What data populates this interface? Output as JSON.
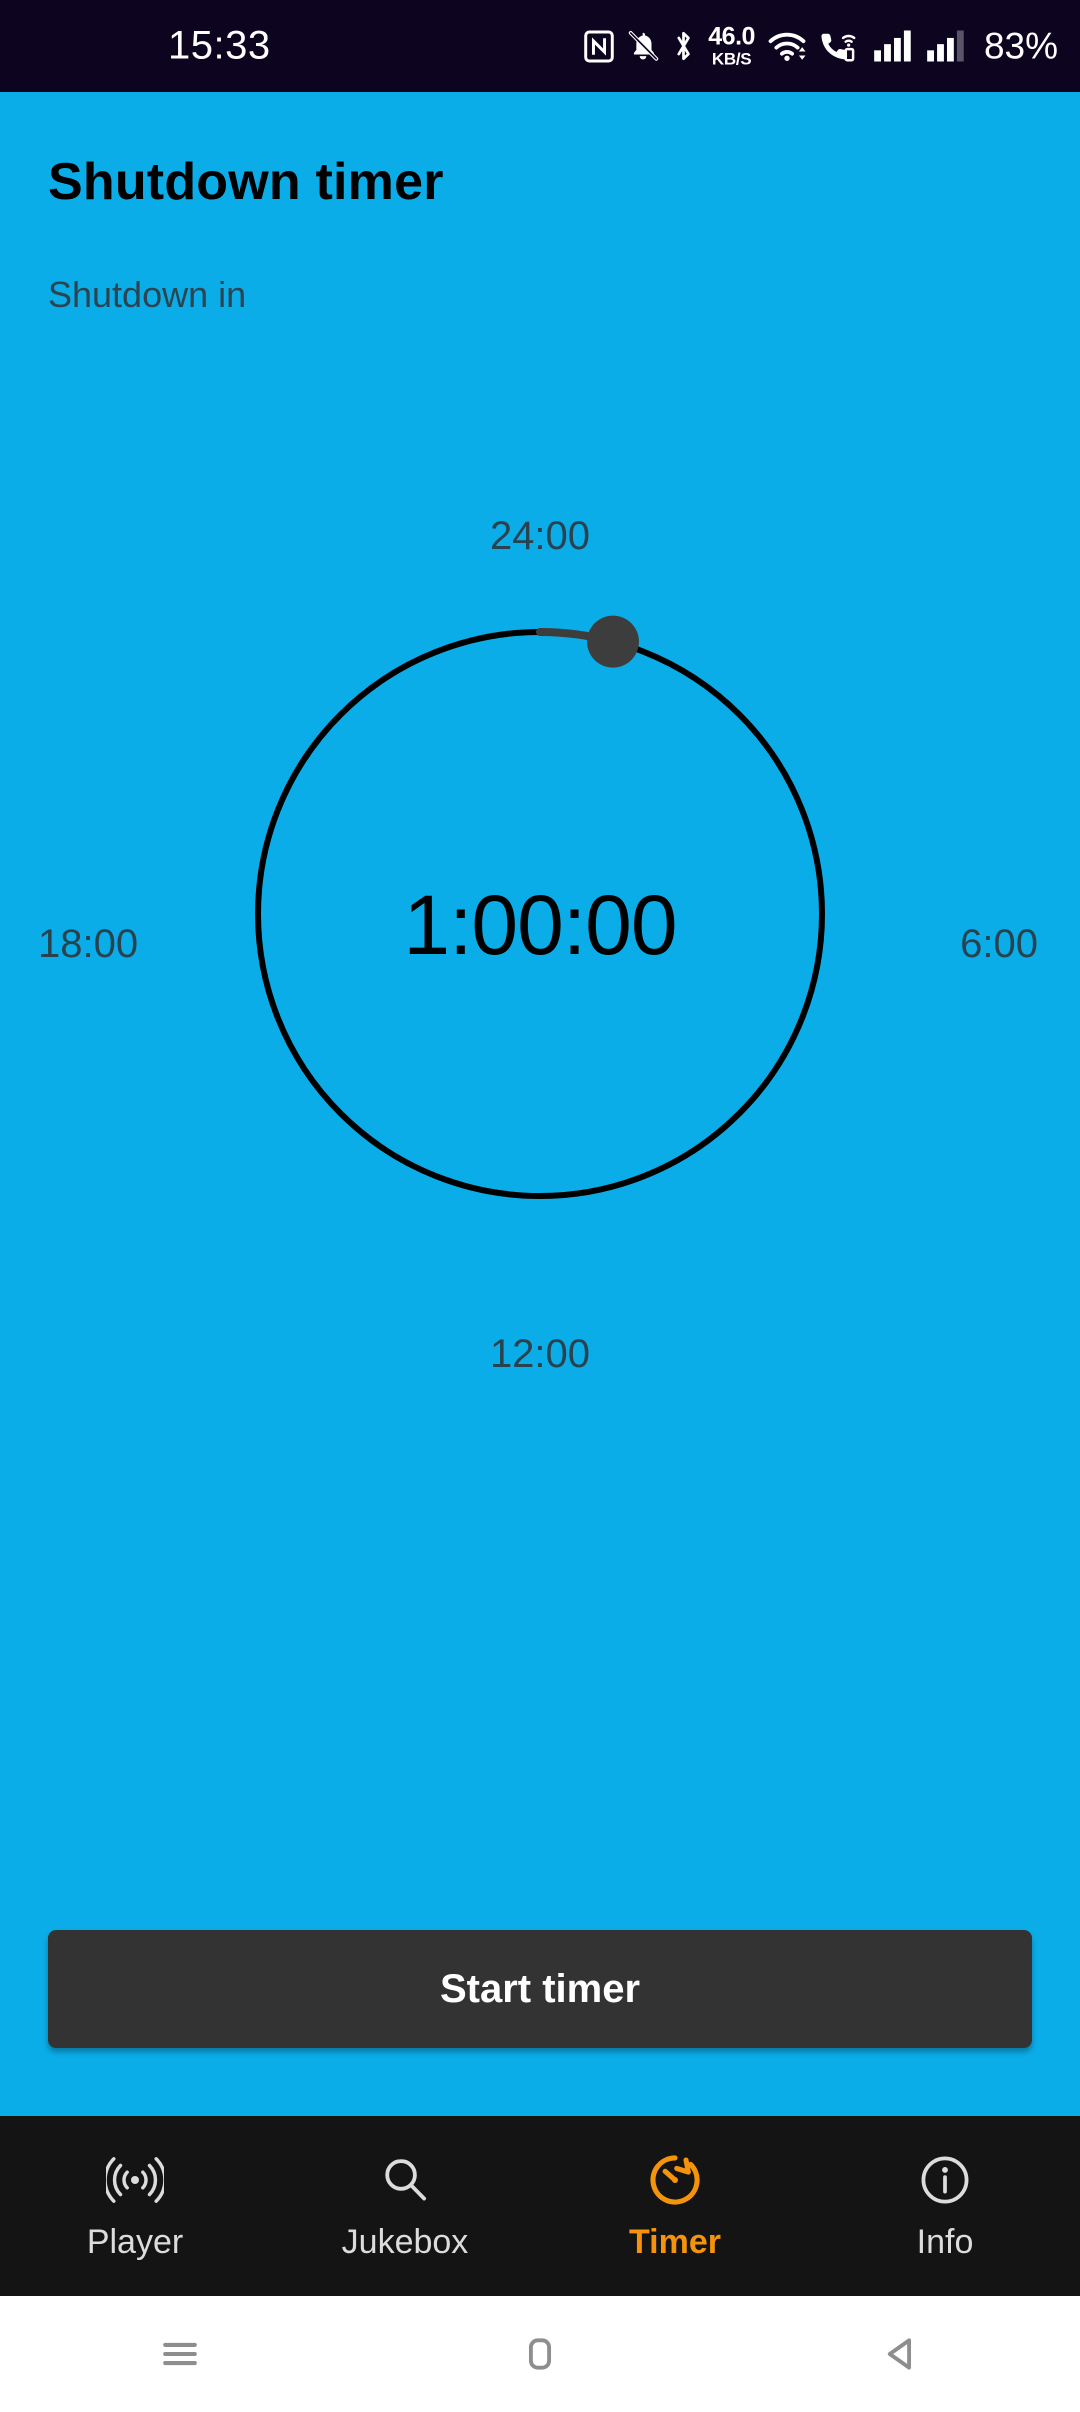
{
  "status_bar": {
    "clock": "15:33",
    "network_speed_value": "46.0",
    "network_speed_unit": "KB/S",
    "battery": "83%",
    "icons": [
      "nfc-icon",
      "bell-muted-icon",
      "bluetooth-icon",
      "wifi-icon",
      "vowifi-call-icon",
      "signal-bars-sim1-icon",
      "signal-bars-sim2-icon"
    ],
    "background_color": "#0d0520"
  },
  "app": {
    "background_color": "#0BADE8",
    "title": "Shutdown timer",
    "subtitle": "Shutdown in"
  },
  "dial": {
    "label_top": "24:00",
    "label_right": "6:00",
    "label_bottom": "12:00",
    "label_left": "18:00",
    "center_value": "1:00:00",
    "handle_angle_degrees": 15,
    "ring_color": "#000000",
    "handle_color": "#3d3d3d",
    "label_color": "#28434f"
  },
  "primary_action": {
    "label": "Start timer",
    "background_color": "#333333",
    "text_color": "#ffffff"
  },
  "tabbar": {
    "background_color": "#141414",
    "active_color": "#F5930A",
    "inactive_color": "#dcdcdc",
    "items": [
      {
        "label": "Player",
        "icon": "broadcast-waves-icon",
        "active": false
      },
      {
        "label": "Jukebox",
        "icon": "search-icon",
        "active": false
      },
      {
        "label": "Timer",
        "icon": "timer-icon",
        "active": true
      },
      {
        "label": "Info",
        "icon": "info-circle-icon",
        "active": false
      }
    ]
  },
  "system_nav": {
    "background_color": "#ffffff",
    "items": [
      {
        "name": "recents-button"
      },
      {
        "name": "home-button"
      },
      {
        "name": "back-button"
      }
    ]
  }
}
